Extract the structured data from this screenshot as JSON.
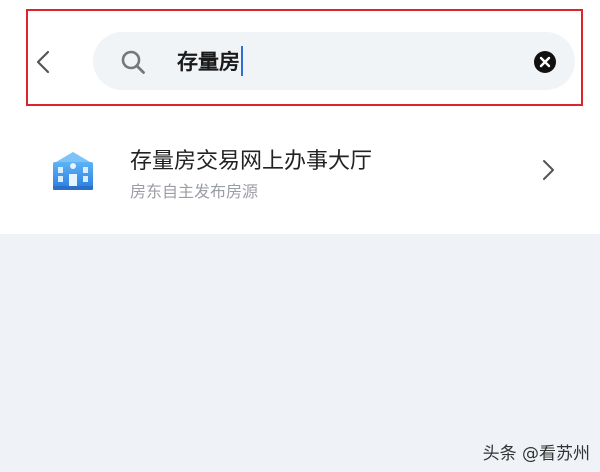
{
  "search": {
    "query": "存量房",
    "back_icon": "chevron-left-icon",
    "search_icon": "magnifier-icon",
    "clear_icon": "clear-circle-icon"
  },
  "results": [
    {
      "title": "存量房交易网上办事大厅",
      "subtitle": "房东自主发布房源",
      "icon": "building-icon"
    }
  ],
  "watermark": "头条 @看苏州",
  "colors": {
    "highlight_border": "#d8262c",
    "caret": "#2f6fd6",
    "icon_blue": "#3a8ee6",
    "background": "#eff3f7"
  }
}
